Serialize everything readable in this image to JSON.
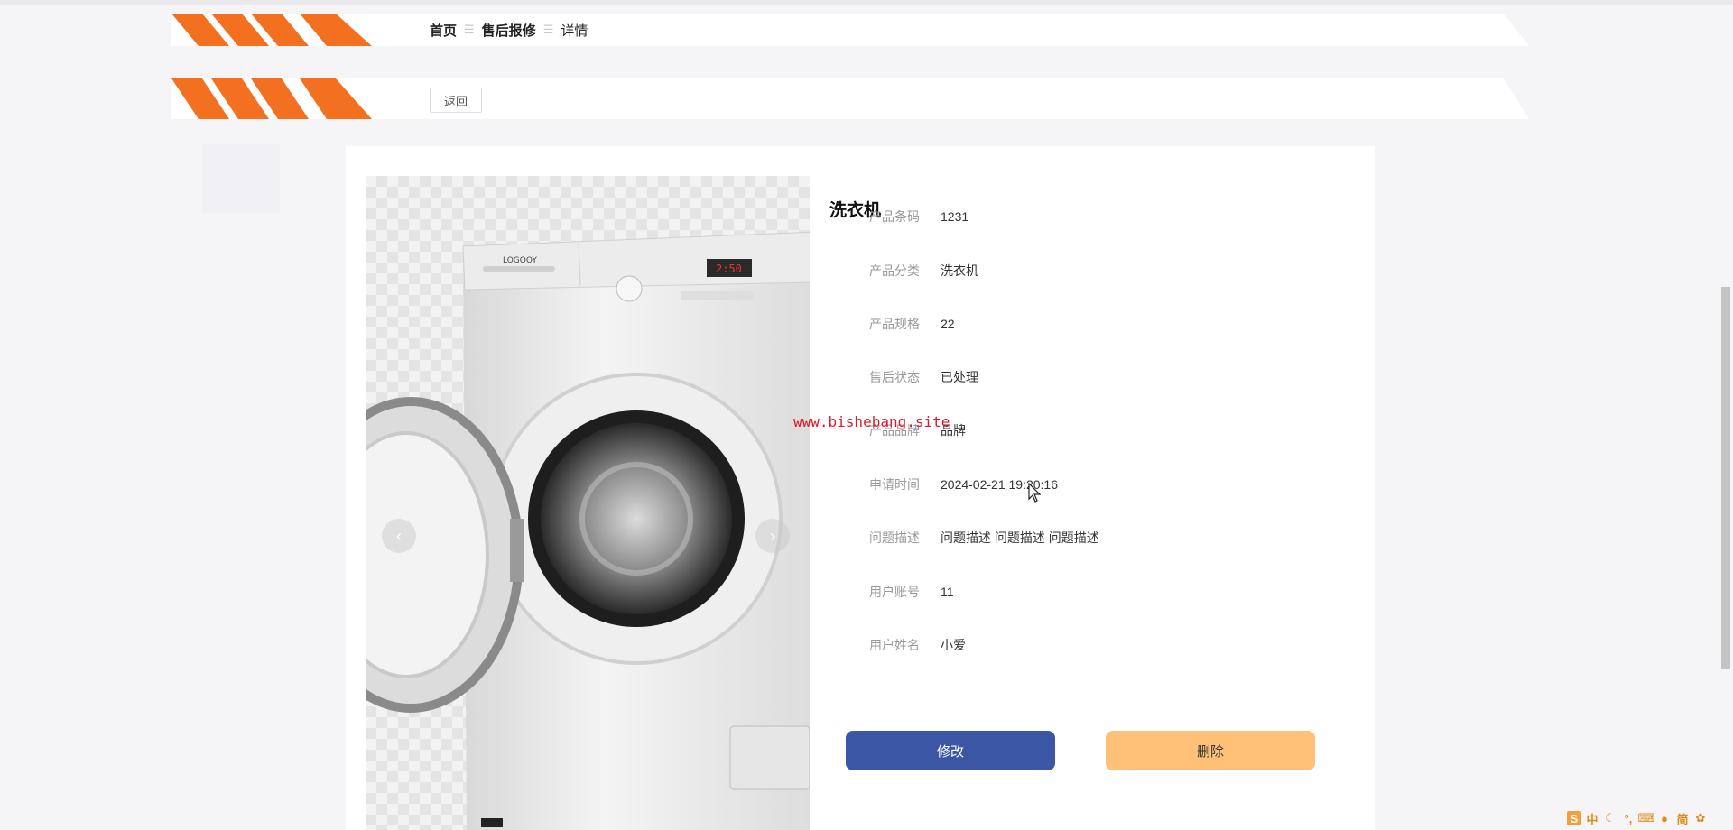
{
  "breadcrumb": {
    "items": [
      "首页",
      "售后报修",
      "详情"
    ]
  },
  "back_button": {
    "label": "返回"
  },
  "product": {
    "name": "洗衣机",
    "fields": [
      {
        "label": "产品条码",
        "value": "1231"
      },
      {
        "label": "产品分类",
        "value": "洗衣机"
      },
      {
        "label": "产品规格",
        "value": "22"
      },
      {
        "label": "售后状态",
        "value": "已处理"
      },
      {
        "label": "产品品牌",
        "value": "品牌"
      },
      {
        "label": "申请时间",
        "value": "2024-02-21 19:20:16"
      },
      {
        "label": "问题描述",
        "value": "问题描述 问题描述 问题描述"
      },
      {
        "label": "用户账号",
        "value": "11"
      },
      {
        "label": "用户姓名",
        "value": "小爱"
      }
    ],
    "image": {
      "brand_text": "LOGOOY",
      "display_text": "2:50"
    }
  },
  "actions": {
    "edit_label": "修改",
    "delete_label": "删除"
  },
  "carousel": {
    "prev_icon": "‹",
    "next_icon": "›"
  },
  "watermark": "www.bishebang.site",
  "tray": {
    "ime_lang": "中",
    "ime_mode": "简"
  },
  "colors": {
    "accent": "#3b56a4",
    "stripe": "#f37021",
    "delete": "#ffc178",
    "watermark": "#e0182c"
  }
}
